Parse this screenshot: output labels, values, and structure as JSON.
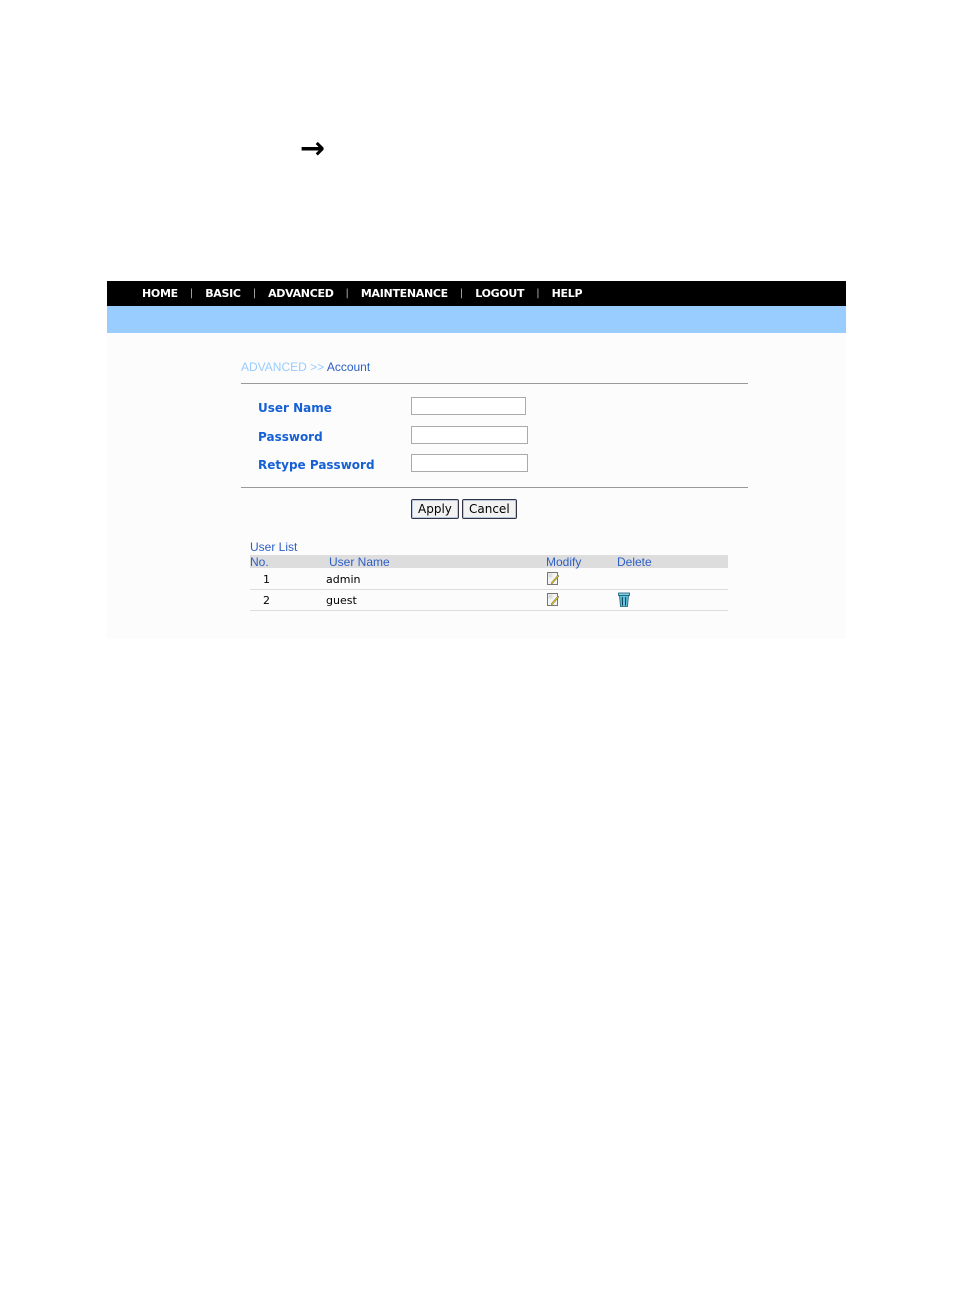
{
  "doc": {
    "arrow_glyph": "→"
  },
  "nav": {
    "items": [
      "HOME",
      "BASIC",
      "ADVANCED",
      "MAINTENANCE",
      "LOGOUT",
      "HELP"
    ],
    "separator": "|"
  },
  "breadcrumb": {
    "section": "ADVANCED >>",
    "page": "Account"
  },
  "form": {
    "user_name": {
      "label": "User Name",
      "value": ""
    },
    "password": {
      "label": "Password",
      "value": ""
    },
    "retype_password": {
      "label": "Retype Password",
      "value": ""
    },
    "apply_label": "Apply",
    "cancel_label": "Cancel"
  },
  "user_list": {
    "title": "User List",
    "columns": [
      "No.",
      "User Name",
      "Modify",
      "Delete"
    ],
    "rows": [
      {
        "no": "1",
        "user_name": "admin",
        "modify_icon": "edit-icon",
        "delete_icon": null
      },
      {
        "no": "2",
        "user_name": "guest",
        "modify_icon": "edit-icon",
        "delete_icon": "trash-icon"
      }
    ]
  },
  "colors": {
    "nav_bg": "#000000",
    "subbar": "#99ccff",
    "label": "#1560d4",
    "link": "#2d5fc6"
  }
}
